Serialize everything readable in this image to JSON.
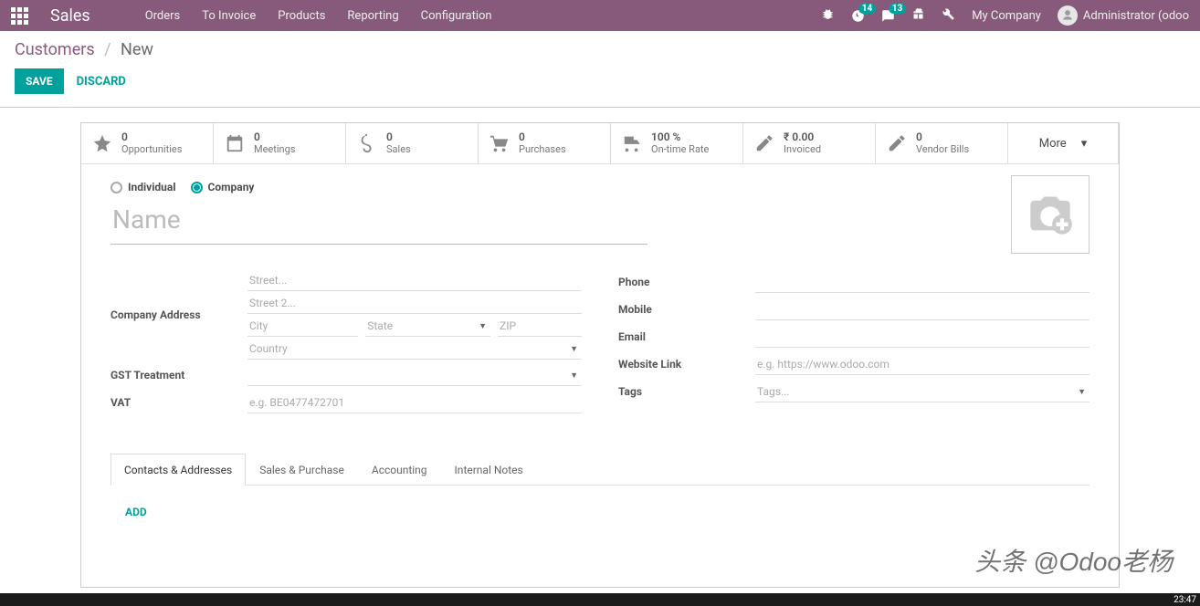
{
  "nav": {
    "brand": "Sales",
    "menu": [
      "Orders",
      "To Invoice",
      "Products",
      "Reporting",
      "Configuration"
    ],
    "activities_badge": "14",
    "messages_badge": "13",
    "company": "My Company",
    "user": "Administrator (odoo"
  },
  "breadcrumb": {
    "parent": "Customers",
    "sep": "/",
    "current": "New"
  },
  "buttons": {
    "save": "SAVE",
    "discard": "DISCARD"
  },
  "stats": [
    {
      "value": "0",
      "label": "Opportunities"
    },
    {
      "value": "0",
      "label": "Meetings"
    },
    {
      "value": "0",
      "label": "Sales"
    },
    {
      "value": "0",
      "label": "Purchases"
    },
    {
      "value": "100 %",
      "label": "On-time Rate"
    },
    {
      "value": "₹ 0.00",
      "label": "Invoiced"
    },
    {
      "value": "0",
      "label": "Vendor Bills"
    }
  ],
  "more_label": "More",
  "company_type": {
    "individual": "Individual",
    "company": "Company",
    "selected": "company"
  },
  "name_placeholder": "Name",
  "labels": {
    "company_address": "Company Address",
    "gst": "GST Treatment",
    "vat": "VAT",
    "phone": "Phone",
    "mobile": "Mobile",
    "email": "Email",
    "website": "Website Link",
    "tags": "Tags"
  },
  "placeholders": {
    "street": "Street...",
    "street2": "Street 2...",
    "city": "City",
    "state": "State",
    "zip": "ZIP",
    "country": "Country",
    "vat": "e.g. BE0477472701",
    "website": "e.g. https://www.odoo.com",
    "tags": "Tags..."
  },
  "tabs": [
    "Contacts & Addresses",
    "Sales & Purchase",
    "Accounting",
    "Internal Notes"
  ],
  "add_label": "ADD",
  "watermark": "头条 @Odoo老杨",
  "clock": "23:47"
}
